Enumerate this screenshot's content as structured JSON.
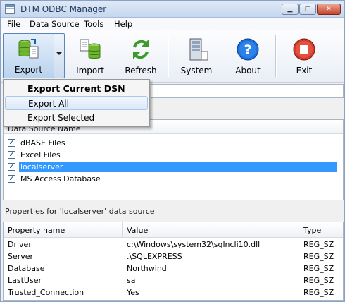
{
  "window": {
    "title": "DTM ODBC Manager",
    "min_glyph": "▁",
    "max_glyph": "□",
    "close_glyph": "✕"
  },
  "menu": [
    "File",
    "Data Source",
    "Tools",
    "Help"
  ],
  "toolbar": {
    "export_label": "Export",
    "import_label": "Import",
    "refresh_label": "Refresh",
    "system_label": "System",
    "about_label": "About",
    "exit_label": "Exit"
  },
  "export_menu": {
    "items": [
      "Export Current DSN",
      "Export All",
      "Export Selected"
    ],
    "highlighted": "Export All"
  },
  "dsn_list": {
    "header": "Data Source Name",
    "items": [
      {
        "name": "dBASE Files",
        "checked": "✓"
      },
      {
        "name": "Excel Files",
        "checked": "✓"
      },
      {
        "name": "localserver",
        "checked": "✓"
      },
      {
        "name": "MS Access Database",
        "checked": "✓"
      }
    ],
    "selected": "localserver"
  },
  "properties": {
    "label": "Properties for 'localserver' data source",
    "columns": [
      "Property name",
      "Value",
      "Type"
    ],
    "rows": [
      [
        "Driver",
        "c:\\Windows\\system32\\sqlncli10.dll",
        "REG_SZ"
      ],
      [
        "Server",
        ".\\SQLEXPRESS",
        "REG_SZ"
      ],
      [
        "Database",
        "Northwind",
        "REG_SZ"
      ],
      [
        "LastUser",
        "sa",
        "REG_SZ"
      ],
      [
        "Trusted_Connection",
        "Yes",
        "REG_SZ"
      ]
    ]
  },
  "colors": {
    "selection": "#3399ff",
    "accent": "#1e395b"
  }
}
